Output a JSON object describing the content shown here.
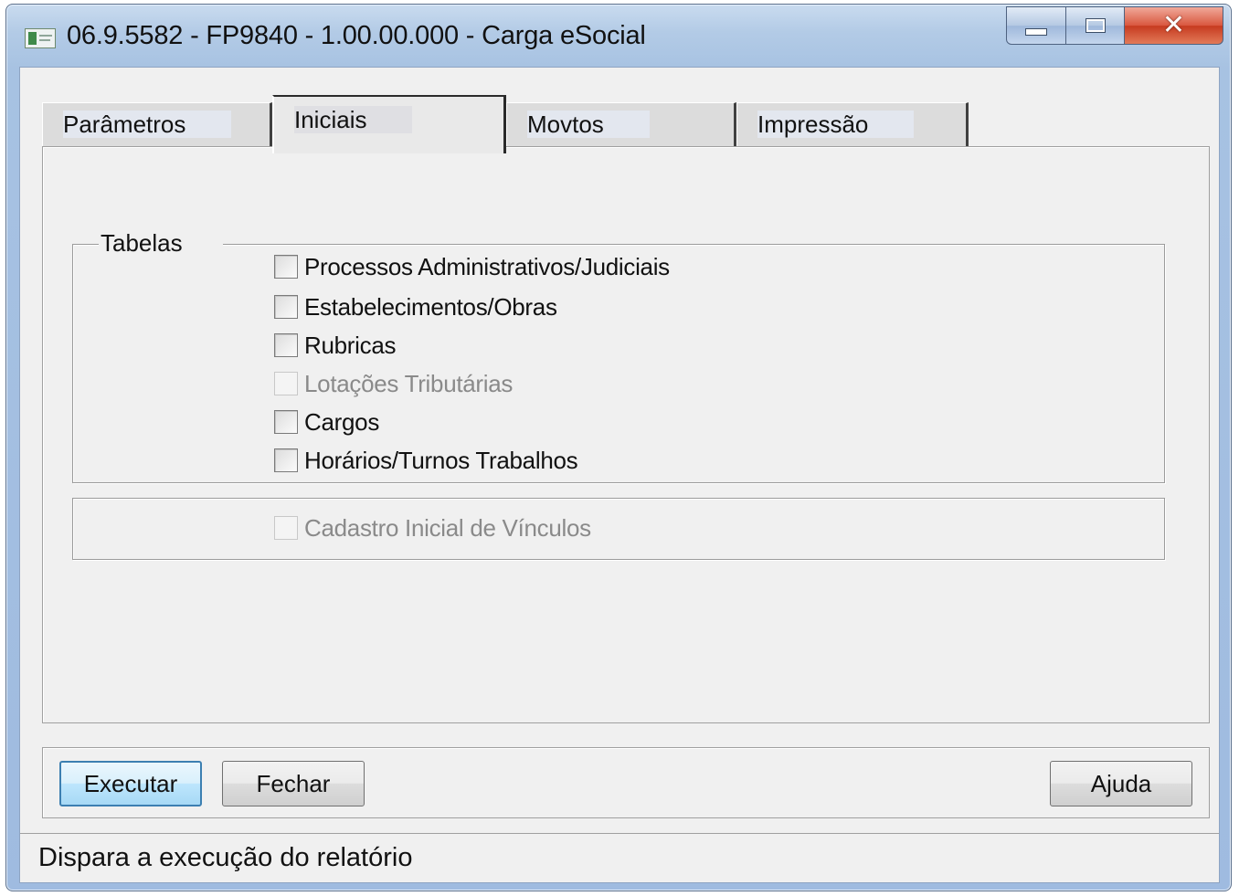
{
  "window": {
    "title": "06.9.5582 - FP9840 - 1.00.00.000 - Carga eSocial",
    "icons": [
      "app-icon",
      "minimize-icon",
      "maximize-icon",
      "close-icon"
    ]
  },
  "tabs": [
    {
      "label": "Parâmetros",
      "active": false
    },
    {
      "label": "Iniciais",
      "active": true
    },
    {
      "label": "Movtos",
      "active": false
    },
    {
      "label": "Impressão",
      "active": false
    }
  ],
  "tabelas_group": {
    "title": "Tabelas",
    "checkboxes": [
      {
        "label": "Processos Administrativos/Judiciais",
        "checked": false,
        "enabled": true
      },
      {
        "label": "Estabelecimentos/Obras",
        "checked": false,
        "enabled": true
      },
      {
        "label": "Rubricas",
        "checked": false,
        "enabled": true
      },
      {
        "label": "Lotações Tributárias",
        "checked": false,
        "enabled": false
      },
      {
        "label": "Cargos",
        "checked": false,
        "enabled": true
      },
      {
        "label": "Horários/Turnos Trabalhos",
        "checked": false,
        "enabled": true
      }
    ]
  },
  "vinculos_group": {
    "checkbox": {
      "label": "Cadastro Inicial de Vínculos",
      "checked": false,
      "enabled": false
    }
  },
  "buttons": {
    "execute_label": "Executar",
    "close_label": "Fechar",
    "help_label": "Ajuda"
  },
  "status": {
    "text": "Dispara a execução do relatório"
  }
}
